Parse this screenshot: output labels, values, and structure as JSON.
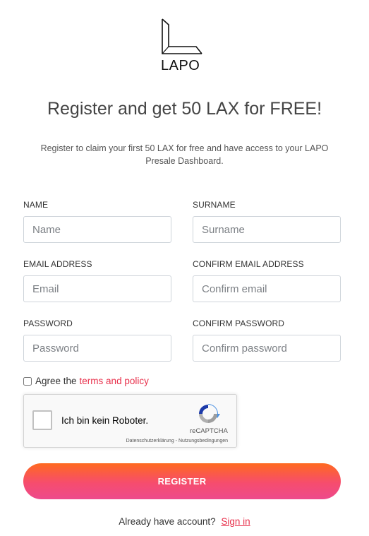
{
  "logo": {
    "text": "LAPO",
    "icon": "lapo-logo-icon"
  },
  "header": {
    "title": "Register and get 50 LAX for FREE!",
    "subtitle": "Register to claim your first 50 LAX for free and have access to your LAPO Presale Dashboard."
  },
  "form": {
    "name": {
      "label": "NAME",
      "placeholder": "Name",
      "value": ""
    },
    "surname": {
      "label": "SURNAME",
      "placeholder": "Surname",
      "value": ""
    },
    "email": {
      "label": "EMAIL ADDRESS",
      "placeholder": "Email",
      "value": ""
    },
    "confirm_email": {
      "label": "CONFIRM EMAIL ADDRESS",
      "placeholder": "Confirm email",
      "value": ""
    },
    "password": {
      "label": "PASSWORD",
      "placeholder": "Password",
      "value": ""
    },
    "confirm_password": {
      "label": "CONFIRM PASSWORD",
      "placeholder": "Confirm password",
      "value": ""
    },
    "agree": {
      "prefix": "Agree the",
      "link_text": "terms and policy",
      "checked": false
    }
  },
  "recaptcha": {
    "label": "Ich bin kein Roboter.",
    "brand": "reCAPTCHA",
    "links": "Datenschutzerklärung - Nutzungsbedingungen",
    "icon": "recaptcha-logo-icon"
  },
  "register_button": {
    "label": "REGISTER"
  },
  "footer": {
    "prompt": "Already have account?",
    "signin_link": "Sign in"
  },
  "colors": {
    "accent": "#e8304b",
    "gradient_start": "#ff6a1f",
    "gradient_end": "#ed4a8c"
  }
}
